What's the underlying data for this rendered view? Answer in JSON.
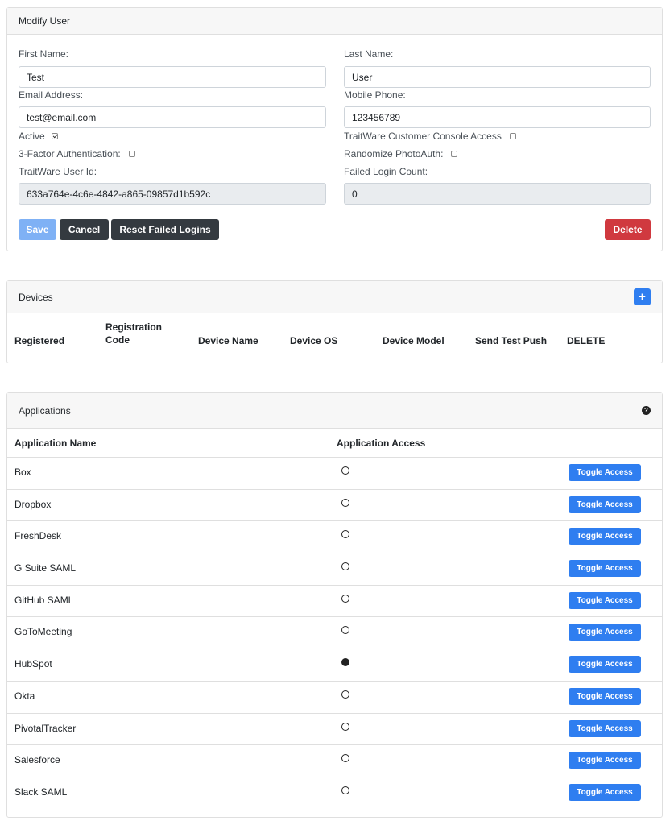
{
  "modify_user": {
    "title": "Modify User",
    "first_name": {
      "label": "First Name:",
      "value": "Test"
    },
    "last_name": {
      "label": "Last Name:",
      "value": "User"
    },
    "email": {
      "label": "Email Address:",
      "value": "test@email.com"
    },
    "mobile": {
      "label": "Mobile Phone:",
      "value": "123456789"
    },
    "active": {
      "label": "Active",
      "checked": true
    },
    "console_access": {
      "label": "TraitWare Customer Console Access",
      "checked": false
    },
    "three_factor": {
      "label": "3-Factor Authentication:",
      "checked": false
    },
    "randomize": {
      "label": "Randomize PhotoAuth:",
      "checked": false
    },
    "user_id": {
      "label": "TraitWare User Id:",
      "value": "633a764e-4c6e-4842-a865-09857d1b592c"
    },
    "failed_count": {
      "label": "Failed Login Count:",
      "value": "0"
    },
    "buttons": {
      "save": "Save",
      "cancel": "Cancel",
      "reset": "Reset Failed Logins",
      "delete": "Delete"
    }
  },
  "devices": {
    "title": "Devices",
    "add_icon": "plus-icon",
    "columns": [
      "Registered",
      "Registration\nCode",
      "Device Name",
      "Device OS",
      "Device Model",
      "Send Test Push",
      "DELETE"
    ]
  },
  "applications": {
    "title": "Applications",
    "help_icon": "question-circle-icon",
    "col_name": "Application Name",
    "col_access": "Application Access",
    "toggle_label": "Toggle Access",
    "rows": [
      {
        "name": "Box",
        "access": false
      },
      {
        "name": "Dropbox",
        "access": false
      },
      {
        "name": "FreshDesk",
        "access": false
      },
      {
        "name": "G Suite SAML",
        "access": false
      },
      {
        "name": "GitHub SAML",
        "access": false
      },
      {
        "name": "GoToMeeting",
        "access": false
      },
      {
        "name": "HubSpot",
        "access": true
      },
      {
        "name": "Okta",
        "access": false
      },
      {
        "name": "PivotalTracker",
        "access": false
      },
      {
        "name": "Salesforce",
        "access": false
      },
      {
        "name": "Slack SAML",
        "access": false
      }
    ]
  },
  "colors": {
    "primary": "#2f7ef0",
    "danger": "#d0393f",
    "dark": "#343a40",
    "save_disabled": "#7fb1f5"
  }
}
